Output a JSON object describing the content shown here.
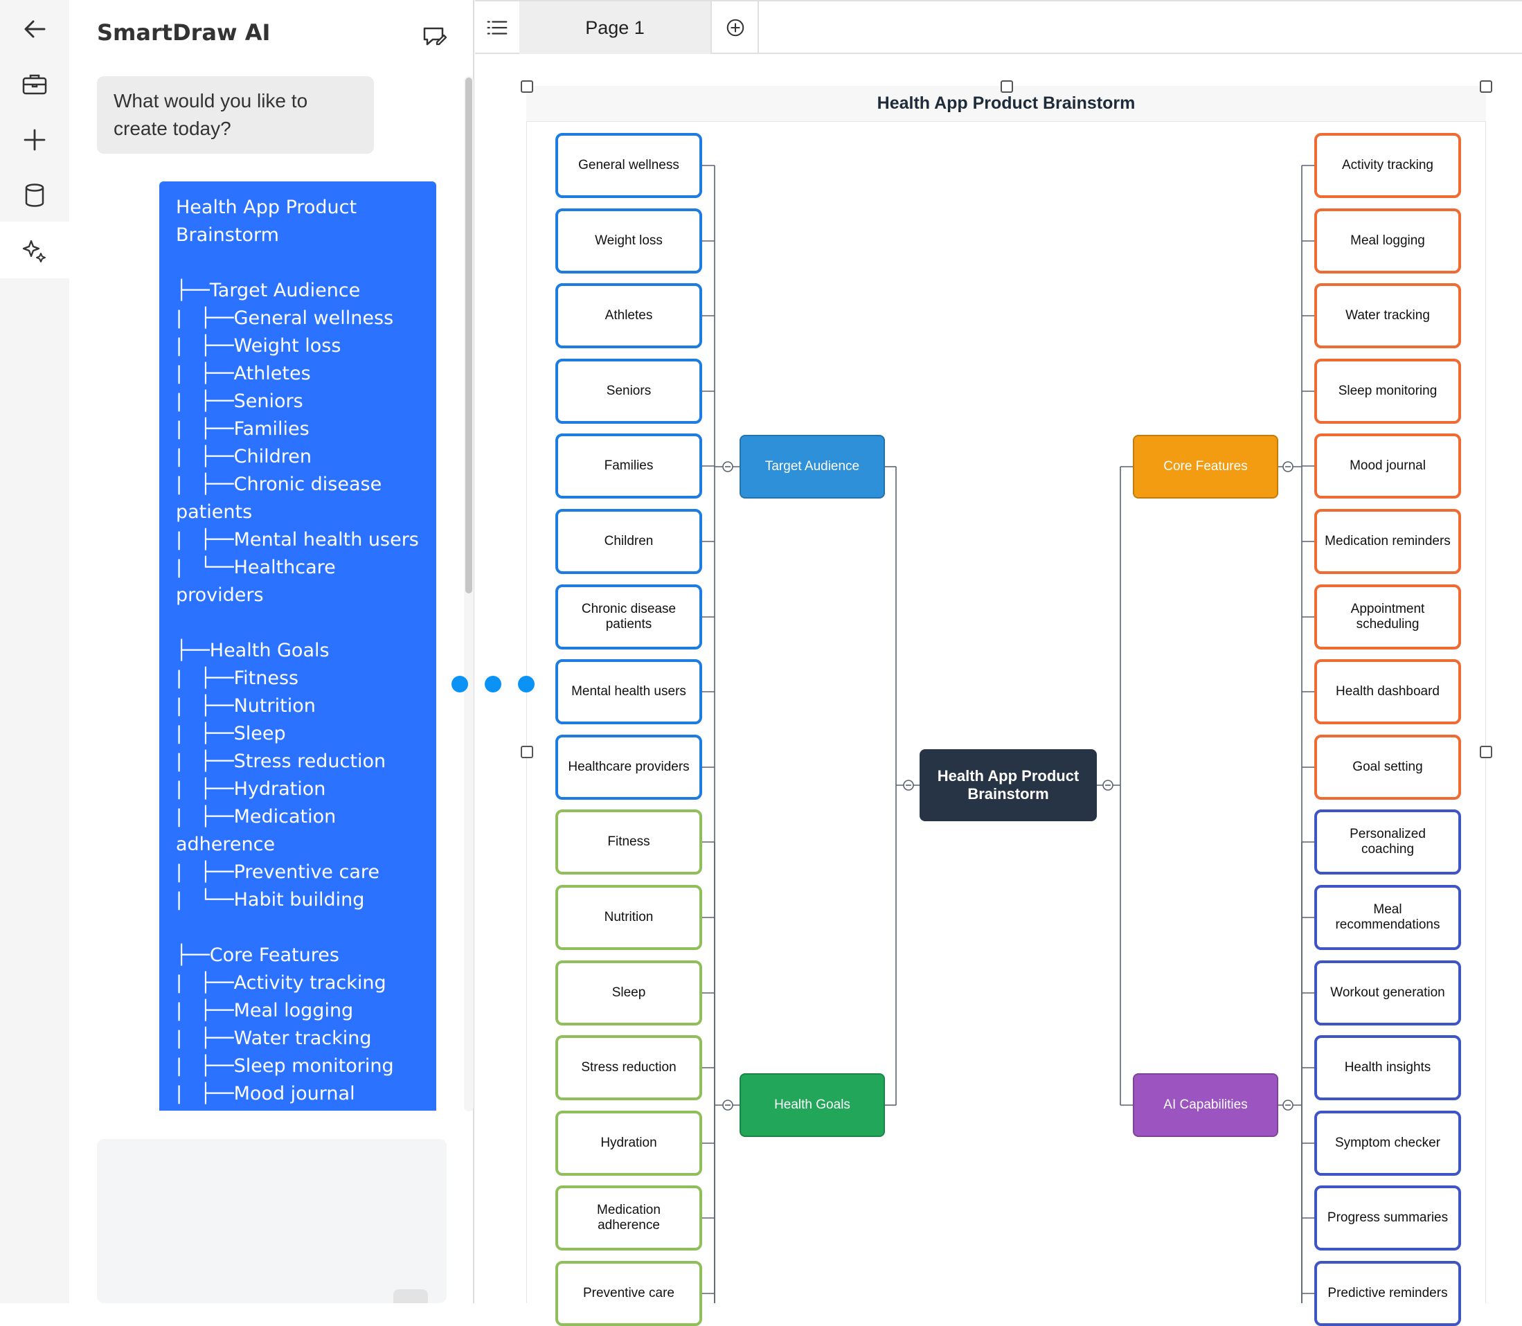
{
  "app": {
    "title": "SmartDraw AI"
  },
  "rail": {
    "items": [
      {
        "name": "back",
        "icon": "arrow-left-icon"
      },
      {
        "name": "templates",
        "icon": "briefcase-icon"
      },
      {
        "name": "new",
        "icon": "plus-icon"
      },
      {
        "name": "data",
        "icon": "database-icon"
      },
      {
        "name": "ai",
        "icon": "sparkle-icon"
      }
    ]
  },
  "chat": {
    "greeting": "What would you like to create today?",
    "user_message": "Health App Product Brainstorm\n\n├──Target Audience\n|   ├──General wellness\n|   ├──Weight loss\n|   ├──Athletes\n|   ├──Seniors\n|   ├──Families\n|   ├──Children\n|   ├──Chronic disease patients\n|   ├──Mental health users\n|   └──Healthcare providers\n\n├──Health Goals\n|   ├──Fitness\n|   ├──Nutrition\n|   ├──Sleep\n|   ├──Stress reduction\n|   ├──Hydration\n|   ├──Medication adherence\n|   ├──Preventive care\n|   └──Habit building\n\n├──Core Features\n|   ├──Activity tracking\n|   ├──Meal logging\n|   ├──Water tracking\n|   ├──Sleep monitoring\n|   ├──Mood journal"
  },
  "tabs": {
    "page_label": "Page 1"
  },
  "colors": {
    "accent": "#2a72ff",
    "target": "#2e90d8",
    "goals": "#22a65a",
    "features": "#f39c12",
    "ai": "#9b54c0",
    "root": "#263445"
  },
  "diagram": {
    "title": "Health App Product Brainstorm",
    "root": "Health App Product Brainstorm",
    "target": {
      "label": "Target Audience",
      "children": [
        "General wellness",
        "Weight loss",
        "Athletes",
        "Seniors",
        "Families",
        "Children",
        "Chronic disease patients",
        "Mental health users",
        "Healthcare providers"
      ]
    },
    "goals": {
      "label": "Health Goals",
      "children": [
        "Fitness",
        "Nutrition",
        "Sleep",
        "Stress reduction",
        "Hydration",
        "Medication adherence",
        "Preventive care"
      ]
    },
    "features": {
      "label": "Core Features",
      "children": [
        "Activity tracking",
        "Meal logging",
        "Water tracking",
        "Sleep monitoring",
        "Mood journal",
        "Medication reminders",
        "Appointment scheduling",
        "Health dashboard",
        "Goal setting"
      ]
    },
    "ai": {
      "label": "AI Capabilities",
      "children": [
        "Personalized coaching",
        "Meal recommendations",
        "Workout generation",
        "Health insights",
        "Symptom checker",
        "Progress summaries",
        "Predictive reminders"
      ]
    }
  }
}
